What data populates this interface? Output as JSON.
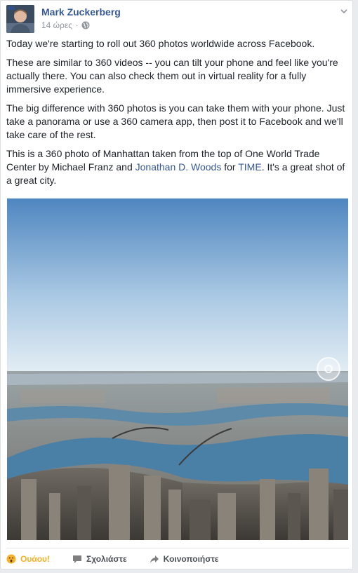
{
  "post": {
    "author": "Mark Zuckerberg",
    "time": "14 ώρες",
    "separator": "·",
    "paragraphs": {
      "p1": "Today we're starting to roll out 360 photos worldwide across Facebook.",
      "p2": "These are similar to 360 videos -- you can tilt your phone and feel like you're actually there. You can also check them out in virtual reality for a fully immersive experience.",
      "p3": "The big difference with 360 photos is you can take them with your phone. Just take a panorama or use a 360 camera app, then post it to Facebook and we'll take care of the rest.",
      "p4_a": "This is a 360 photo of Manhattan taken from the top of One World Trade Center by Michael Franz and ",
      "p4_link1": "Jonathan D. Woods",
      "p4_b": " for ",
      "p4_link2": "TIME",
      "p4_c": ". It's a great shot of a great city."
    }
  },
  "actions": {
    "reaction": "Ουάου!",
    "comment": "Σχολιάστε",
    "share": "Κοινοποιήστε"
  },
  "colors": {
    "link": "#365899",
    "meta": "#90949c",
    "reaction": "#f7b125"
  },
  "icons": [
    "avatar",
    "globe-icon",
    "chevron-down-icon",
    "view-360-icon",
    "wow-emoji-icon",
    "comment-icon",
    "share-icon"
  ]
}
